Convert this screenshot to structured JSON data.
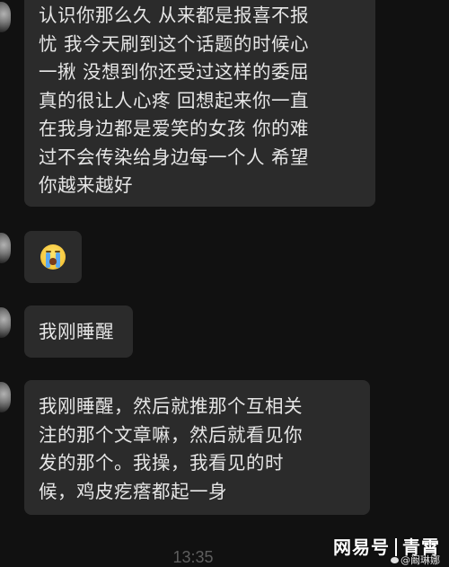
{
  "messages": [
    {
      "lines": [
        "认识你那么久 从来都是报喜不报",
        "忧 我今天刷到这个话题的时候心",
        "一揪 没想到你还受过这样的委屈",
        "真的很让人心疼 回想起来你一直",
        "在我身边都是爱笑的女孩 你的难",
        "过不会传染给身边每一个人 希望",
        "你越来越好"
      ]
    },
    {
      "emoji": "loudly-crying-face"
    },
    {
      "lines": [
        "我刚睡醒"
      ]
    },
    {
      "lines": [
        "我刚睡醒，然后就推那个互相关",
        "注的那个文章嘛，然后就看见你",
        "发的那个。我操，我看见的时",
        "候，鸡皮疙瘩都起一身"
      ]
    }
  ],
  "timestamp": "13:35",
  "watermark": {
    "brand": "网易号",
    "author": "青霄",
    "weibo_user": "@阚琳娜"
  },
  "colors": {
    "background": "#111111",
    "bubble": "#2b2b2b",
    "text": "#e6e6e6",
    "timestamp": "#5e5e5e"
  }
}
